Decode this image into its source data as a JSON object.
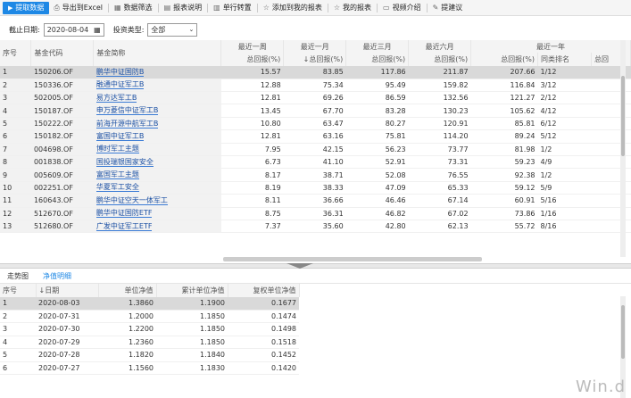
{
  "toolbar": {
    "extract_label": "提取数据",
    "export_label": "导出到Excel",
    "filter_label": "数据筛选",
    "report_label": "报表说明",
    "rotate_label": "单行转置",
    "add_label": "添加到我的报表",
    "my_report_label": "我的报表",
    "video_label": "视频介绍",
    "suggest_label": "提建议"
  },
  "filter": {
    "date_label": "截止日期:",
    "date_value": "2020-08-04",
    "type_label": "投资类型:",
    "type_value": "全部"
  },
  "top_table": {
    "group_headers": {
      "seq": "序号",
      "code": "基金代码",
      "name": "基金简称",
      "w1": "最近一周",
      "m1": "最近一月",
      "m3": "最近三月",
      "m6": "最近六月",
      "y1": "最近一年"
    },
    "sub_headers": {
      "w1": "总回报(%)",
      "m1": "总回报(%)",
      "m3": "总回报(%)",
      "m6": "总回报(%)",
      "y1": "总回报(%)",
      "rank": "同类排名",
      "extra": "总回"
    },
    "sort_arrow": "↓",
    "rows": [
      {
        "seq": "1",
        "code": "150206.OF",
        "name": "鹏华中证国防B",
        "w1": "15.57",
        "m1": "83.85",
        "m3": "117.86",
        "m6": "211.87",
        "y1": "207.66",
        "rank": "1/12"
      },
      {
        "seq": "2",
        "code": "150336.OF",
        "name": "融通中证军工B",
        "w1": "12.88",
        "m1": "75.34",
        "m3": "95.49",
        "m6": "159.82",
        "y1": "116.84",
        "rank": "3/12"
      },
      {
        "seq": "3",
        "code": "502005.OF",
        "name": "易方达军工B",
        "w1": "12.81",
        "m1": "69.26",
        "m3": "86.59",
        "m6": "132.56",
        "y1": "121.27",
        "rank": "2/12"
      },
      {
        "seq": "4",
        "code": "150187.OF",
        "name": "申万菱信中证军工B",
        "w1": "13.45",
        "m1": "67.70",
        "m3": "83.28",
        "m6": "130.23",
        "y1": "105.62",
        "rank": "4/12"
      },
      {
        "seq": "5",
        "code": "150222.OF",
        "name": "前海开源中航军工B",
        "w1": "10.80",
        "m1": "63.47",
        "m3": "80.27",
        "m6": "120.91",
        "y1": "85.81",
        "rank": "6/12"
      },
      {
        "seq": "6",
        "code": "150182.OF",
        "name": "富国中证军工B",
        "w1": "12.81",
        "m1": "63.16",
        "m3": "75.81",
        "m6": "114.20",
        "y1": "89.24",
        "rank": "5/12"
      },
      {
        "seq": "7",
        "code": "004698.OF",
        "name": "博时军工主题",
        "w1": "7.95",
        "m1": "42.15",
        "m3": "56.23",
        "m6": "73.77",
        "y1": "81.98",
        "rank": "1/2"
      },
      {
        "seq": "8",
        "code": "001838.OF",
        "name": "国投瑞银国家安全",
        "w1": "6.73",
        "m1": "41.10",
        "m3": "52.91",
        "m6": "73.31",
        "y1": "59.23",
        "rank": "4/9"
      },
      {
        "seq": "9",
        "code": "005609.OF",
        "name": "富国军工主题",
        "w1": "8.17",
        "m1": "38.71",
        "m3": "52.08",
        "m6": "76.55",
        "y1": "92.38",
        "rank": "1/2"
      },
      {
        "seq": "10",
        "code": "002251.OF",
        "name": "华夏军工安全",
        "w1": "8.19",
        "m1": "38.33",
        "m3": "47.09",
        "m6": "65.33",
        "y1": "59.12",
        "rank": "5/9"
      },
      {
        "seq": "11",
        "code": "160643.OF",
        "name": "鹏华中证空天一体军工",
        "w1": "8.11",
        "m1": "36.66",
        "m3": "46.46",
        "m6": "67.14",
        "y1": "60.91",
        "rank": "5/16"
      },
      {
        "seq": "12",
        "code": "512670.OF",
        "name": "鹏华中证国防ETF",
        "w1": "8.75",
        "m1": "36.31",
        "m3": "46.82",
        "m6": "67.02",
        "y1": "73.86",
        "rank": "1/16"
      },
      {
        "seq": "13",
        "code": "512680.OF",
        "name": "广发中证军工ETF",
        "w1": "7.37",
        "m1": "35.60",
        "m3": "42.80",
        "m6": "62.13",
        "y1": "55.72",
        "rank": "8/16"
      }
    ]
  },
  "bottom_tabs": {
    "trend": "走势图",
    "nav_detail": "净值明细"
  },
  "bottom_table": {
    "headers": {
      "seq": "序号",
      "date": "日期",
      "unit_nav": "单位净值",
      "acc_nav": "累计单位净值",
      "adj_nav": "复权单位净值"
    },
    "sort_arrow": "↓",
    "rows": [
      {
        "seq": "1",
        "date": "2020-08-03",
        "unit_nav": "1.3860",
        "acc_nav": "1.1900",
        "adj_nav": "0.1677"
      },
      {
        "seq": "2",
        "date": "2020-07-31",
        "unit_nav": "1.2000",
        "acc_nav": "1.1850",
        "adj_nav": "0.1474"
      },
      {
        "seq": "3",
        "date": "2020-07-30",
        "unit_nav": "1.2200",
        "acc_nav": "1.1850",
        "adj_nav": "0.1498"
      },
      {
        "seq": "4",
        "date": "2020-07-29",
        "unit_nav": "1.2360",
        "acc_nav": "1.1850",
        "adj_nav": "0.1518"
      },
      {
        "seq": "5",
        "date": "2020-07-28",
        "unit_nav": "1.1820",
        "acc_nav": "1.1840",
        "adj_nav": "0.1452"
      },
      {
        "seq": "6",
        "date": "2020-07-27",
        "unit_nav": "1.1560",
        "acc_nav": "1.1830",
        "adj_nav": "0.1420"
      }
    ]
  },
  "watermark": "Win.d"
}
